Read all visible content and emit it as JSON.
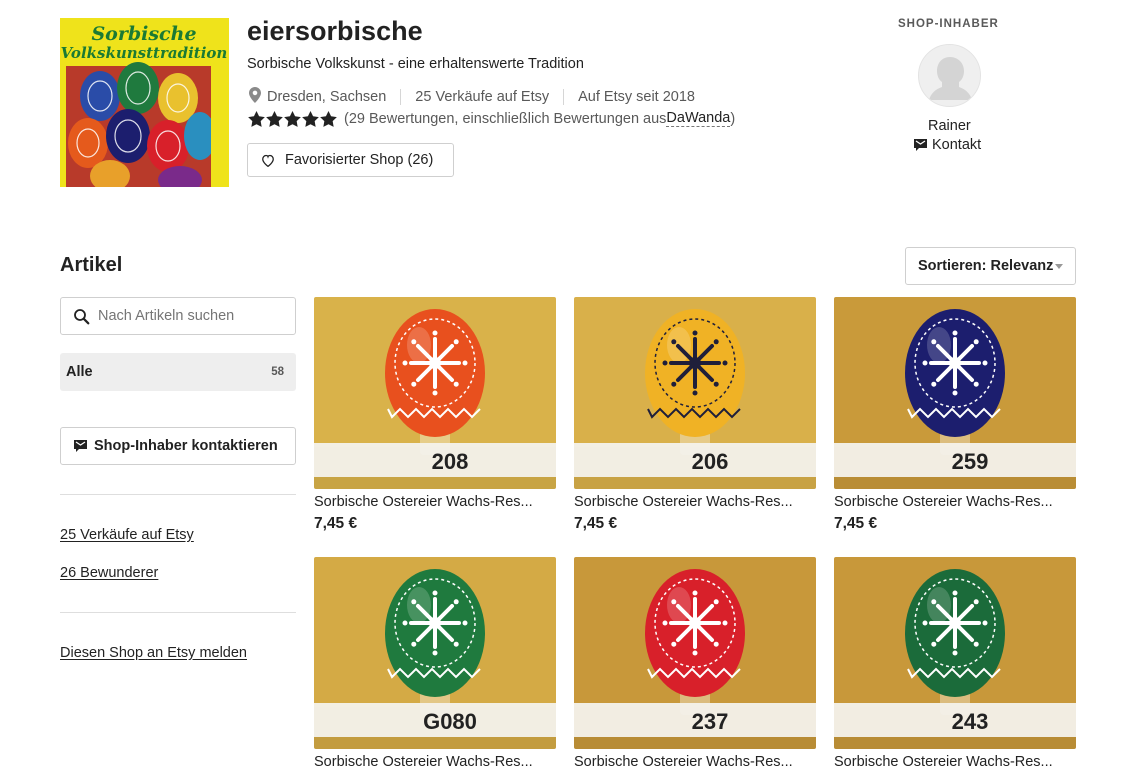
{
  "shop": {
    "name": "eiersorbische",
    "tagline": "Sorbische Volkskunst - eine erhaltenswerte Tradition",
    "location": "Dresden, Sachsen",
    "sales": "25 Verkäufe auf Etsy",
    "since": "Auf Etsy seit 2018",
    "rating_stars": 5,
    "reviews_text": "(29 Bewertungen, einschließlich Bewertungen aus ",
    "reviews_source": "DaWanda",
    "reviews_close": ")",
    "favorite_label": "Favorisierter Shop (26)",
    "logo_text_line1": "Sorbische",
    "logo_text_line2": "Volkskunsttradition"
  },
  "owner": {
    "section_label": "SHOP-INHABER",
    "name": "Rainer",
    "contact_label": "Kontakt"
  },
  "section": {
    "title": "Artikel",
    "sort_label": "Sortieren: Relevanz"
  },
  "sidebar": {
    "search_placeholder": "Nach Artikeln suchen",
    "category_all": "Alle",
    "category_all_count": "58",
    "contact_button": "Shop-Inhaber kontaktieren",
    "sales_link": "25 Verkäufe auf Etsy",
    "admirers_link": "26 Bewunderer",
    "report_link": "Diesen Shop an Etsy melden"
  },
  "listings": [
    {
      "title": "Sorbische Ostereier Wachs-Reserve",
      "price": "7,45 €",
      "label": "208",
      "egg_color": "#e8501e",
      "pattern_color": "#ffffff",
      "bg": "#d9b24a"
    },
    {
      "title": "Sorbische Ostereier Wachs-Reserve",
      "price": "7,45 €",
      "label": "206",
      "egg_color": "#f0b225",
      "pattern_color": "#1f1f3a",
      "bg": "#d9b04a"
    },
    {
      "title": "Sorbische Ostereier Wachs-Reserve",
      "price": "7,45 €",
      "label": "259",
      "egg_color": "#1c1e6e",
      "pattern_color": "#ffffff",
      "bg": "#c99a3a"
    },
    {
      "title": "Sorbische Ostereier Wachs-Reserve",
      "price": "",
      "label": "G080",
      "egg_color": "#1f7a3e",
      "pattern_color": "#ffffff",
      "bg": "#d4aa45"
    },
    {
      "title": "Sorbische Ostereier Wachs-Reserve",
      "price": "",
      "label": "237",
      "egg_color": "#d8202a",
      "pattern_color": "#ffffff",
      "bg": "#c8983a"
    },
    {
      "title": "Sorbische Ostereier Wachs-Reserve",
      "price": "",
      "label": "243",
      "egg_color": "#1b6b3a",
      "pattern_color": "#ffffff",
      "bg": "#c8983a"
    }
  ]
}
